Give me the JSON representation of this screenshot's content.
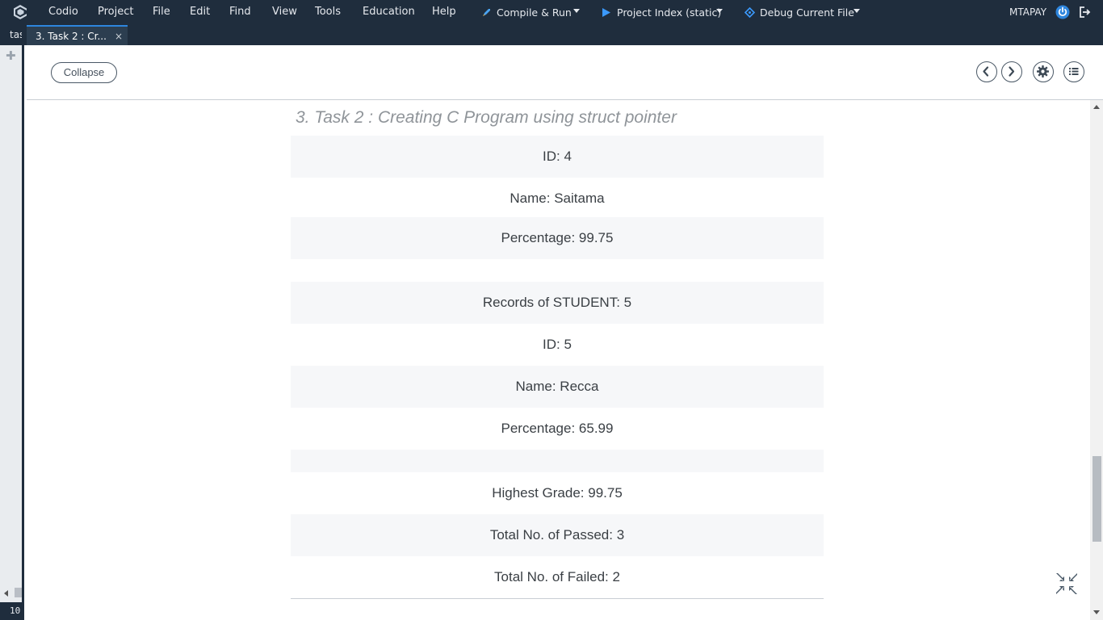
{
  "menubar": {
    "items": [
      "Codio",
      "Project",
      "File",
      "Edit",
      "Find",
      "View",
      "Tools",
      "Education",
      "Help"
    ],
    "run_actions": {
      "compile_run": "Compile & Run",
      "project_index": "Project Index (static)",
      "debug": "Debug Current File"
    },
    "username": "MTAPAY"
  },
  "left_strip": {
    "tab_stub": "tas",
    "line_indicator": "10"
  },
  "tabs": [
    {
      "label": "3. Task 2 : Cr...",
      "close": "×"
    }
  ],
  "guide": {
    "collapse_label": "Collapse",
    "title": "3. Task 2 : Creating C Program using struct pointer",
    "rows": [
      {
        "text": "ID: 4",
        "shaded": true
      },
      {
        "text": "Name: Saitama",
        "shaded": false
      },
      {
        "text": "Percentage: 99.75",
        "shaded": true
      },
      {
        "text": "",
        "shaded": false
      },
      {
        "text": "Records of STUDENT: 5",
        "shaded": true
      },
      {
        "text": "ID: 5",
        "shaded": false
      },
      {
        "text": "Name: Recca",
        "shaded": true
      },
      {
        "text": "Percentage: 65.99",
        "shaded": false
      },
      {
        "text": "",
        "shaded": true
      },
      {
        "text": "Highest Grade: 99.75",
        "shaded": false
      },
      {
        "text": "Total No. of Passed: 3",
        "shaded": true
      },
      {
        "text": "Total No. of Failed: 2",
        "shaded": false
      }
    ]
  },
  "icons": {
    "logo": "codio-logo-icon",
    "compile": "rocket-icon",
    "run": "play-icon",
    "debug": "debug-icon",
    "power": "power-icon",
    "logout": "logout-icon",
    "prev": "chevron-left-icon",
    "next": "chevron-right-icon",
    "settings": "gear-icon",
    "toc": "list-icon",
    "fullscreen": "fullscreen-exit-icon"
  },
  "colors": {
    "menubar_bg": "#1f2d3d",
    "accent": "#2e86de",
    "row_shade": "#f6f7f9"
  }
}
